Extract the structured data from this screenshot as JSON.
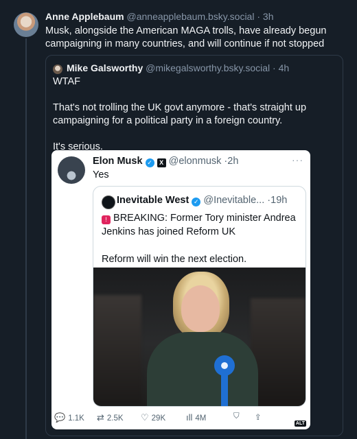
{
  "post": {
    "author_name": "Anne Applebaum",
    "handle": "@anneapplebaum.bsky.social",
    "time": "3h",
    "text": "Musk, alongside the American MAGA trolls, have already begun campaigning in many countries, and will continue if not stopped"
  },
  "quote": {
    "author_name": "Mike Galsworthy",
    "handle": "@mikegalsworthy.bsky.social",
    "time": "4h",
    "paragraphs": [
      "WTAF",
      "That's not trolling the UK govt anymore - that's straight up campaigning for a political party in a foreign country.",
      "It's serious."
    ]
  },
  "screenshot": {
    "author_name": "Elon Musk",
    "handle": "@elonmusk",
    "time": "2h",
    "more": "···",
    "text": "Yes",
    "inner": {
      "author_name": "Inevitable West",
      "handle": "@Inevitable...",
      "time": "19h",
      "breaking": "BREAKING: Former Tory minister Andrea Jenkins has joined Reform UK",
      "second": "Reform will win the next election."
    },
    "actions": {
      "replies": "1.1K",
      "reposts": "2.5K",
      "likes": "29K",
      "views": "4M"
    },
    "alt_badge": "ALT"
  },
  "icons": {
    "verified": "verified-badge-icon",
    "x_logo": "x-logo-icon",
    "reply": "reply-icon",
    "repost": "repost-icon",
    "like": "heart-icon",
    "views": "views-icon",
    "bookmark": "bookmark-icon",
    "share": "share-icon"
  },
  "colors": {
    "background": "#161e27",
    "accent": "#1d9bf0",
    "muted": "#8796a8"
  }
}
